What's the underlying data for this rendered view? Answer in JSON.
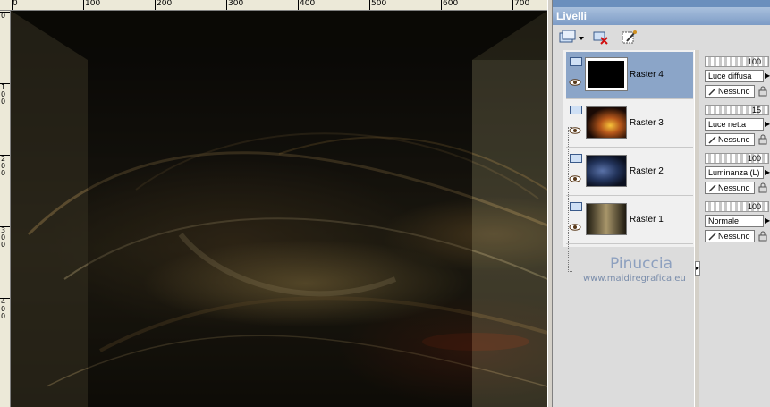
{
  "ruler": {
    "top_labels": [
      "0",
      "100",
      "200",
      "300",
      "400",
      "500",
      "600",
      "700"
    ],
    "left_labels": [
      "0",
      "100",
      "200",
      "300",
      "400"
    ]
  },
  "palette": {
    "title": "Livelli",
    "toolbar": {
      "new_layer_icon": "new-raster-layer-icon",
      "delete_layer_icon": "delete-layer-icon",
      "properties_icon": "layer-properties-icon"
    },
    "layers": [
      {
        "name": "Raster 4",
        "selected": true,
        "opacity": "100",
        "blend": "Luce diffusa",
        "mask": "Nessuno"
      },
      {
        "name": "Raster 3",
        "selected": false,
        "opacity": "15",
        "blend": "Luce netta",
        "mask": "Nessuno"
      },
      {
        "name": "Raster 2",
        "selected": false,
        "opacity": "100",
        "blend": "Luminanza (L)",
        "mask": "Nessuno"
      },
      {
        "name": "Raster 1",
        "selected": false,
        "opacity": "100",
        "blend": "Normale",
        "mask": "Nessuno"
      }
    ],
    "watermark": {
      "name": "Pinuccia",
      "url": "www.maidiregrafica.eu"
    }
  },
  "colors": {
    "title_bar": "#7d9cc6",
    "selected_layer": "#8ba5c8",
    "canvas_base": "#15120b"
  }
}
